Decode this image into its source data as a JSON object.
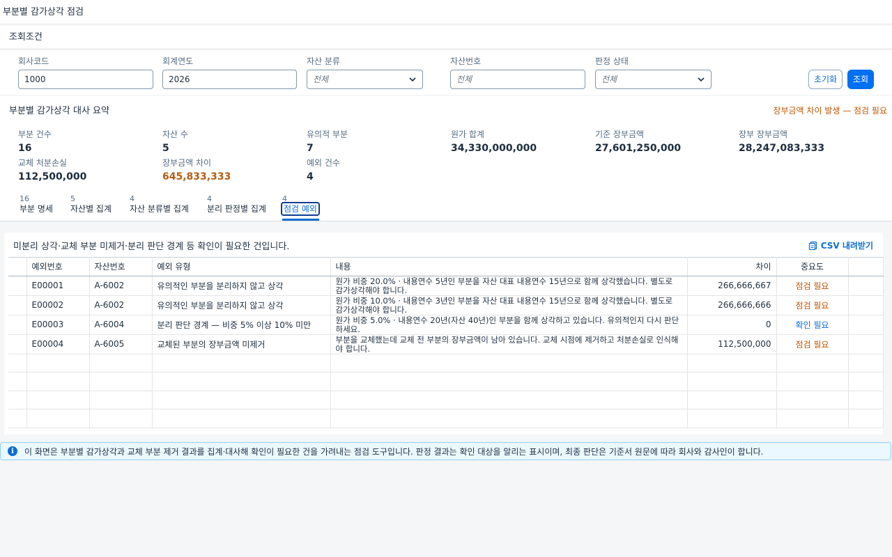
{
  "page": {
    "title": "부분별 감가상각 점검"
  },
  "filters": {
    "panel_title": "조회조건",
    "company_code": {
      "label": "회사코드",
      "value": "1000"
    },
    "fiscal_year": {
      "label": "회계연도",
      "value": "2026"
    },
    "asset_class": {
      "label": "자산 분류",
      "value": "전체"
    },
    "asset_number": {
      "label": "자산번호",
      "placeholder": "전체"
    },
    "judgment_status": {
      "label": "판정 상태",
      "value": "전체"
    },
    "reset_label": "초기화",
    "search_label": "조회"
  },
  "summary": {
    "title": "부분별 감가상각 대사 요약",
    "alert": "장부금액 차이 발생 — 점검 필요",
    "kpis": [
      {
        "label": "부분 건수",
        "value": "16"
      },
      {
        "label": "자산 수",
        "value": "5"
      },
      {
        "label": "유의적 부분",
        "value": "7"
      },
      {
        "label": "원가 합계",
        "value": "34,330,000,000"
      },
      {
        "label": "기준 장부금액",
        "value": "27,601,250,000"
      },
      {
        "label": "장부 장부금액",
        "value": "28,247,083,333"
      },
      {
        "label": "교체 처분손실",
        "value": "112,500,000"
      },
      {
        "label": "장부금액 차이",
        "value": "645,833,333"
      },
      {
        "label": "예외 건수",
        "value": "4"
      }
    ]
  },
  "tabs": [
    {
      "count": "16",
      "label": "부분 명세"
    },
    {
      "count": "5",
      "label": "자산별 집계"
    },
    {
      "count": "4",
      "label": "자산 분류별 집계"
    },
    {
      "count": "4",
      "label": "분리 판정별 집계"
    },
    {
      "count": "4",
      "label": "점검 예외"
    }
  ],
  "exceptions": {
    "hint": "미분리 상각·교체 부분 미제거·분리 판단 경계 등 확인이 필요한 건입니다.",
    "csv_label": "CSV 내려받기",
    "columns": [
      "예외번호",
      "자산번호",
      "예외 유형",
      "내용",
      "차이",
      "중요도"
    ],
    "rows": [
      {
        "id": "E00001",
        "asset": "A-6002",
        "type": "유의적인 부분을 분리하지 않고 상각",
        "detail": "원가 비중 20.0% · 내용연수 5년인 부분을 자산 대표 내용연수 15년으로 함께 상각했습니다. 별도로 감가상각해야 합니다.",
        "diff": "266,666,667",
        "severity": "점검 필요"
      },
      {
        "id": "E00002",
        "asset": "A-6002",
        "type": "유의적인 부분을 분리하지 않고 상각",
        "detail": "원가 비중 10.0% · 내용연수 3년인 부분을 자산 대표 내용연수 15년으로 함께 상각했습니다. 별도로 감가상각해야 합니다.",
        "diff": "266,666,666",
        "severity": "점검 필요"
      },
      {
        "id": "E00003",
        "asset": "A-6004",
        "type": "분리 판단 경계 — 비중 5% 이상 10% 미만",
        "detail": "원가 비중 5.0% · 내용연수 20년(자산 40년)인 부분을 함께 상각하고 있습니다. 유의적인지 다시 판단하세요.",
        "diff": "0",
        "severity": "확인 필요"
      },
      {
        "id": "E00004",
        "asset": "A-6005",
        "type": "교체된 부분의 장부금액 미제거",
        "detail": "부분을 교체했는데 교체 전 부분의 장부금액이 남아 있습니다. 교체 시점에 제거하고 처분손실로 인식해야 합니다.",
        "diff": "112,500,000",
        "severity": "점검 필요"
      }
    ]
  },
  "info": {
    "text": "이 화면은 부분별 감가상각과 교체 부분 제거 결과를 집계·대사해 확인이 필요한 건을 가려내는 점검 도구입니다. 판정 결과는 확인 대상을 알리는 표시이며, 최종 판단은 기준서 원문에 따라 회사와 감사인이 합니다."
  },
  "colors": {
    "accent": "#0a6ed1",
    "warning": "#c35500",
    "warning_value": "#b55d12",
    "primary_button": "#0070f2"
  }
}
